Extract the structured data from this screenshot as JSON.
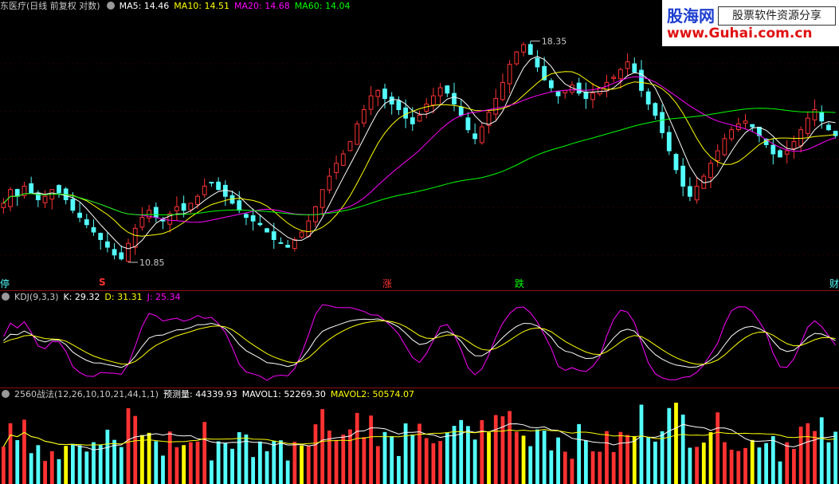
{
  "header": {
    "title": "东医疗(日线 前复权 对数)",
    "ma": [
      {
        "label": "MA5: 14.46",
        "color": "#ffffff"
      },
      {
        "label": "MA10: 14.51",
        "color": "#ffff00"
      },
      {
        "label": "MA20: 14.68",
        "color": "#ff00ff"
      },
      {
        "label": "MA60: 14.04",
        "color": "#00ff00"
      }
    ]
  },
  "logo": {
    "brand": "股海网",
    "slogan": "股票软件资源分享",
    "url": "www.Guhai.com.cn"
  },
  "price_labels": {
    "high": "18.35",
    "low": "10.85"
  },
  "signals": {
    "left_edge": "停",
    "s_mark": "S",
    "up": "涨",
    "down": "跌",
    "right_edge": "财"
  },
  "kdj_header": {
    "name": "KDJ(9,3,3)",
    "k": "K: 29.32",
    "d": "D: 31.31",
    "j": "J: 25.34"
  },
  "vol_header": {
    "name": "2560战法(12,26,10,10,21,44,1,1)",
    "forecast": "预测量: 44339.93",
    "mavol1": "MAVOL1: 52269.30",
    "mavol2": "MAVOL2: 50574.07"
  },
  "colors": {
    "up": "#ff3232",
    "down": "#54ffff",
    "ma5": "#ffffff",
    "ma10": "#ffff00",
    "ma20": "#ff00ff",
    "ma60": "#00ff00",
    "kdj_j": "#ff00ff"
  },
  "chart_data": {
    "type": "candlestick",
    "y_scale": "log",
    "ylim": [
      10.5,
      19.2
    ],
    "closes": [
      12.4,
      12.8,
      12.6,
      12.9,
      12.7,
      12.5,
      12.6,
      12.8,
      12.7,
      12.5,
      12.2,
      12.0,
      11.8,
      11.6,
      11.4,
      11.2,
      11.0,
      10.9,
      11.3,
      11.7,
      12.0,
      12.2,
      12.0,
      11.9,
      12.1,
      12.3,
      12.2,
      12.4,
      12.6,
      12.9,
      13.0,
      12.8,
      12.6,
      12.4,
      12.2,
      12.0,
      11.9,
      11.8,
      11.6,
      11.4,
      11.3,
      11.2,
      11.4,
      11.6,
      11.9,
      12.3,
      12.8,
      13.2,
      13.6,
      13.9,
      14.3,
      14.9,
      15.4,
      15.9,
      16.1,
      15.8,
      15.6,
      15.4,
      15.1,
      14.9,
      15.2,
      15.6,
      15.9,
      16.2,
      16.0,
      15.6,
      15.2,
      14.7,
      14.4,
      14.8,
      15.3,
      15.8,
      16.4,
      17.1,
      17.6,
      17.9,
      17.5,
      17.0,
      16.5,
      16.2,
      15.9,
      16.1,
      16.3,
      16.0,
      15.8,
      16.0,
      16.2,
      16.4,
      16.6,
      16.9,
      17.2,
      16.8,
      16.1,
      15.6,
      15.2,
      14.6,
      14.0,
      13.4,
      12.9,
      12.6,
      12.9,
      13.2,
      13.6,
      14.0,
      14.4,
      14.7,
      14.9,
      15.0,
      14.8,
      14.5,
      14.2,
      13.9,
      13.8,
      14.0,
      14.3,
      14.7,
      15.1,
      15.4,
      15.0,
      14.7,
      14.5
    ]
  }
}
